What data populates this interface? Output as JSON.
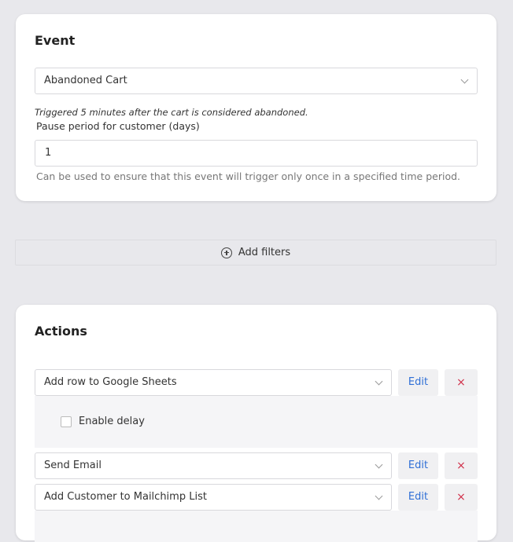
{
  "event": {
    "title": "Event",
    "selected_event": "Abandoned Cart",
    "trigger_hint": "Triggered 5 minutes after the cart is considered abandoned.",
    "pause_label": "Pause period for customer (days)",
    "pause_value": "1",
    "pause_help": "Can be used to ensure that this event will trigger only once in a specified time period."
  },
  "filters": {
    "add_label": "Add filters"
  },
  "actions": {
    "title": "Actions",
    "items": [
      {
        "label": "Add row to Google Sheets",
        "edit": "Edit",
        "delete": "×",
        "delay_label": "Enable delay"
      },
      {
        "label": "Send Email",
        "edit": "Edit",
        "delete": "×"
      },
      {
        "label": "Add Customer to Mailchimp List",
        "edit": "Edit",
        "delete": "×"
      }
    ]
  },
  "colors": {
    "background": "#e8e8ec",
    "card": "#ffffff",
    "link": "#2f6fd6",
    "danger": "#d0304a"
  }
}
